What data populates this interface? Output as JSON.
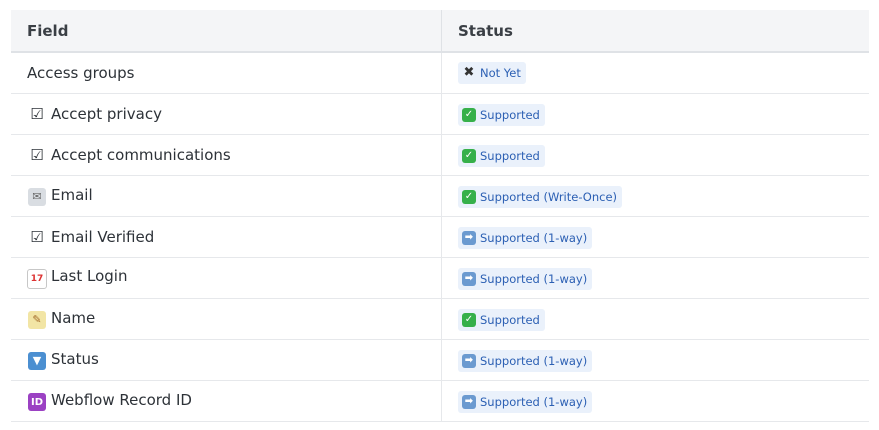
{
  "table": {
    "headers": {
      "field": "Field",
      "status": "Status"
    },
    "rows": [
      {
        "icon": "none",
        "field": "Access groups",
        "status_icon": "x-icon",
        "status_icon_glyph": "✖",
        "status": "Not Yet"
      },
      {
        "icon": "checkbox-icon",
        "icon_glyph": "☑",
        "field": "Accept privacy",
        "status_icon": "check-icon",
        "status_icon_glyph": "✓",
        "status": "Supported"
      },
      {
        "icon": "checkbox-icon",
        "icon_glyph": "☑",
        "field": "Accept communications",
        "status_icon": "check-icon",
        "status_icon_glyph": "✓",
        "status": "Supported"
      },
      {
        "icon": "envelope-icon",
        "icon_glyph": "✉",
        "field": "Email",
        "status_icon": "check-icon",
        "status_icon_glyph": "✓",
        "status": "Supported (Write-Once)"
      },
      {
        "icon": "checkbox-icon",
        "icon_glyph": "☑",
        "field": "Email Verified",
        "status_icon": "arrow-right-icon",
        "status_icon_glyph": "➡",
        "status": "Supported (1-way)"
      },
      {
        "icon": "calendar-icon",
        "icon_glyph": "17",
        "field": "Last Login",
        "status_icon": "arrow-right-icon",
        "status_icon_glyph": "➡",
        "status": "Supported (1-way)"
      },
      {
        "icon": "memo-icon",
        "icon_glyph": "✎",
        "field": "Name",
        "status_icon": "check-icon",
        "status_icon_glyph": "✓",
        "status": "Supported"
      },
      {
        "icon": "dropdown-icon",
        "icon_glyph": "▼",
        "field": "Status",
        "status_icon": "arrow-right-icon",
        "status_icon_glyph": "➡",
        "status": "Supported (1-way)"
      },
      {
        "icon": "id-icon",
        "icon_glyph": "ID",
        "field": "Webflow Record ID",
        "status_icon": "arrow-right-icon",
        "status_icon_glyph": "➡",
        "status": "Supported (1-way)"
      }
    ]
  }
}
